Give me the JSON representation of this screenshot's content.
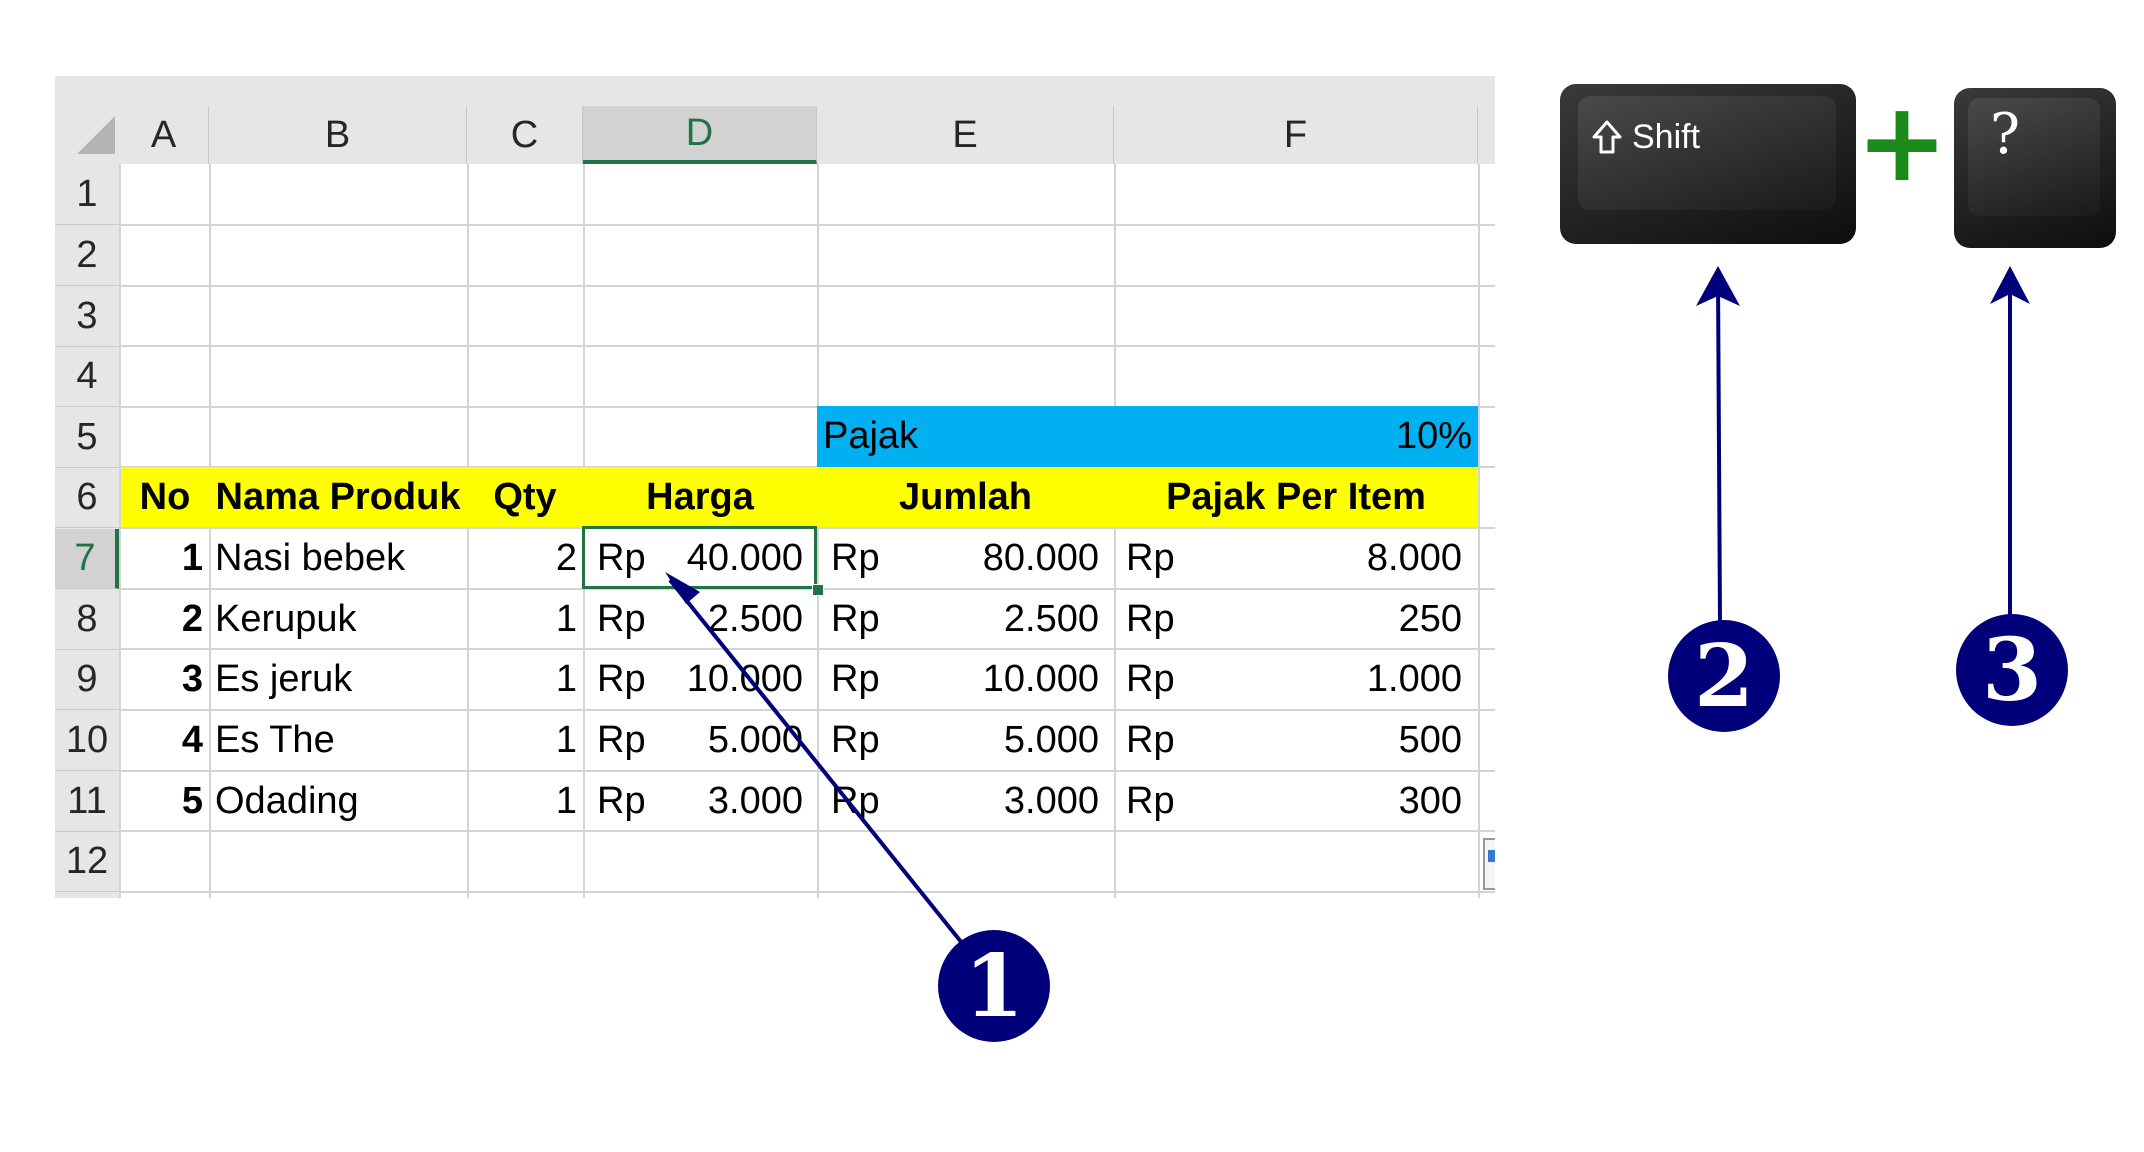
{
  "spreadsheet": {
    "columns": [
      "A",
      "B",
      "C",
      "D",
      "E",
      "F"
    ],
    "selected_column": "D",
    "rows": [
      "1",
      "2",
      "3",
      "4",
      "5",
      "6",
      "7",
      "8",
      "9",
      "10",
      "11",
      "12"
    ],
    "selected_row": "7",
    "tax_label": "Pajak",
    "tax_value": "10%",
    "headers": {
      "no": "No",
      "product": "Nama Produk",
      "qty": "Qty",
      "price": "Harga",
      "total": "Jumlah",
      "tax_per_item": "Pajak Per Item"
    },
    "currency": "Rp",
    "items": [
      {
        "no": "1",
        "product": "Nasi bebek",
        "qty": "2",
        "price": "40.000",
        "total": "80.000",
        "tax": "8.000"
      },
      {
        "no": "2",
        "product": "Kerupuk",
        "qty": "1",
        "price": "2.500",
        "total": "2.500",
        "tax": "250"
      },
      {
        "no": "3",
        "product": "Es jeruk",
        "qty": "1",
        "price": "10.000",
        "total": "10.000",
        "tax": "1.000"
      },
      {
        "no": "4",
        "product": "Es The",
        "qty": "1",
        "price": "5.000",
        "total": "5.000",
        "tax": "500"
      },
      {
        "no": "5",
        "product": "Odading",
        "qty": "1",
        "price": "3.000",
        "total": "3.000",
        "tax": "300"
      }
    ]
  },
  "keyboard": {
    "shift_label": "Shift",
    "shift_icon": "shift-arrow-icon",
    "plus": "+",
    "question_label": "?",
    "plus_color": "#1a8a1a"
  },
  "callouts": [
    "1",
    "2",
    "3"
  ],
  "callout_color": "#00007a"
}
